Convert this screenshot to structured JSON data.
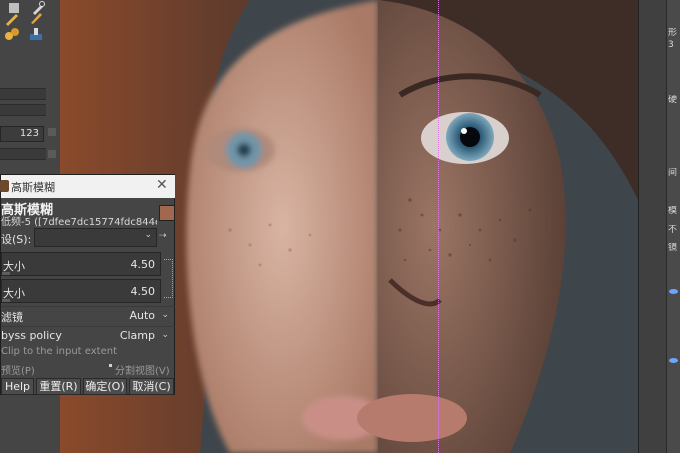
{
  "toolbox": {
    "number_value": "123"
  },
  "dialog": {
    "window_title": "高斯模糊",
    "header_title": "高斯模糊",
    "header_subtitle": "低频-5 ([7dfee7dc15774fdc844e9a9...",
    "preset_label": "设(S):",
    "size_x_label": "大小",
    "size_x_value": "4.50",
    "size_y_label": "大小",
    "size_y_value": "4.50",
    "filter_label": "滤镜",
    "filter_value": "Auto",
    "abyss_label": "byss policy",
    "abyss_value": "Clamp",
    "clip_label": "Clip to the input extent",
    "preview_label": "预览(P)",
    "split_label": "分割视图(V)",
    "buttons": {
      "help": "Help",
      "reset": "重置(R)",
      "ok": "确定(O)",
      "cancel": "取消(C)"
    }
  },
  "right_dock": {
    "labels": [
      "形",
      "3",
      "硬",
      "间",
      "模",
      "不",
      "镜"
    ]
  },
  "colors": {
    "accent_eye": "#6aa6ff",
    "divider_guide": "#d77ad8"
  }
}
